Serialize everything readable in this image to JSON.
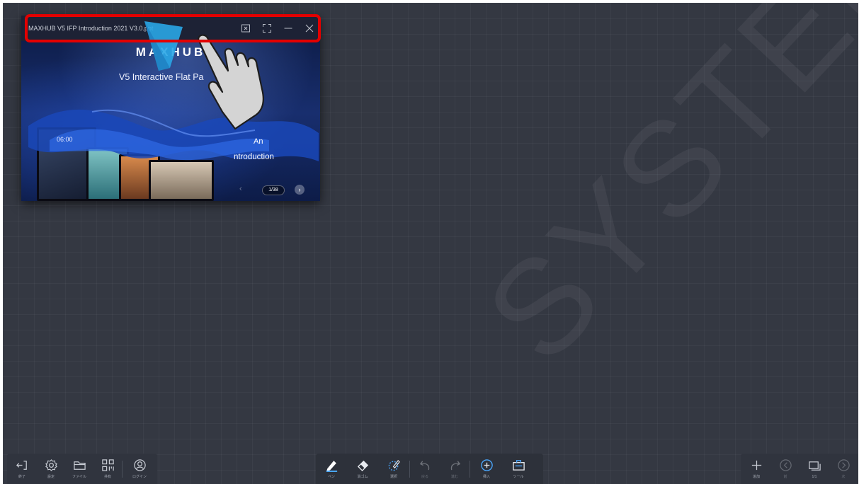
{
  "window": {
    "title": "MAXHUB V5 IFP Introduction 2021 V3.0.ppt",
    "buttons": [
      "exit-slideshow-icon",
      "fullscreen-icon",
      "minimize-icon",
      "close-icon"
    ]
  },
  "slide": {
    "brand": "MAXHUB",
    "subtitle": "V5 Interactive Flat Pa",
    "intro_line1": "An",
    "intro_line2": "ntroduction",
    "clock": "06:00",
    "page_counter": "1/38"
  },
  "toolbar_left": [
    {
      "icon": "exit-icon",
      "label": "終了"
    },
    {
      "icon": "gear-icon",
      "label": "設定"
    },
    {
      "icon": "folder-icon",
      "label": "ファイル"
    },
    {
      "icon": "qr-code-icon",
      "label": "共有"
    },
    {
      "icon": "user-icon",
      "label": "ログイン"
    }
  ],
  "toolbar_center": [
    {
      "icon": "pen-icon",
      "label": "ペン"
    },
    {
      "icon": "eraser-icon",
      "label": "消ゴム"
    },
    {
      "icon": "lasso-select-icon",
      "label": "選択"
    },
    {
      "icon": "undo-icon",
      "label": "戻る"
    },
    {
      "icon": "redo-icon",
      "label": "進む"
    },
    {
      "icon": "insert-plus-icon",
      "label": "挿入"
    },
    {
      "icon": "toolbox-icon",
      "label": "ツール"
    }
  ],
  "toolbar_right": [
    {
      "icon": "add-page-icon",
      "label": "追加"
    },
    {
      "icon": "prev-page-icon",
      "label": "前"
    },
    {
      "icon": "pages-icon",
      "label": "1/1"
    },
    {
      "icon": "next-page-icon",
      "label": "次"
    }
  ],
  "watermark": "SYSTEM",
  "colors": {
    "board": "#343842",
    "highlight": "#e30000",
    "accent_blue": "#4aa8ff",
    "hand_arrow": "#2aa6e6"
  }
}
